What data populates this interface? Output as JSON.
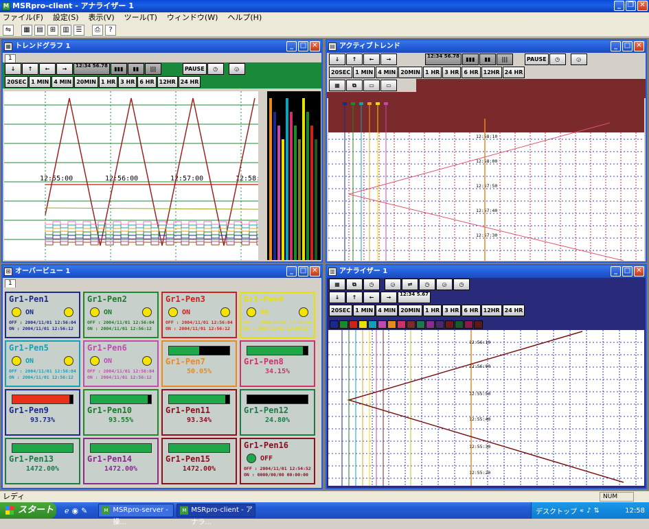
{
  "app": {
    "title": "MSRpro-client - アナライザー 1"
  },
  "menu": [
    "ファイル(F)",
    "設定(S)",
    "表示(V)",
    "ツール(T)",
    "ウィンドウ(W)",
    "ヘルプ(H)"
  ],
  "windows": {
    "trend": {
      "title": "トレンドグラフ 1",
      "tab": "1",
      "ranges": [
        "20SEC",
        "1 MIN",
        "4 MIN",
        "20MIN",
        "1 HR",
        "3 HR",
        "6 HR",
        "12HR",
        "24 HR"
      ],
      "pause": "PAUSE",
      "time_box": "12:34 56.78",
      "times": [
        "12:55:00",
        "12:56:00",
        "12:57:00",
        "12:58:00"
      ]
    },
    "active": {
      "title": "アクティブトレンド",
      "ranges": [
        "20SEC",
        "1 MIN",
        "4 MIN",
        "20MIN",
        "1 HR",
        "3 HR",
        "6 HR",
        "12HR",
        "24 HR"
      ],
      "pause": "PAUSE",
      "time_box": "12:34 56.78",
      "times": [
        "12:58:10",
        "12:58:00",
        "12:57:50",
        "12:57:40",
        "12:57:30",
        "12:57:20"
      ]
    },
    "overview": {
      "title": "オーバービュー 1",
      "tab": "1"
    },
    "analyzer": {
      "title": "アナライザー 1",
      "time_box": "12:34 5.67",
      "ranges": [
        "20SEC",
        "1 MIN",
        "4 MIN",
        "20MIN",
        "1 HR",
        "3 HR",
        "6 HR",
        "12HR",
        "24 HR"
      ],
      "times": [
        "12:56:10",
        "12:56:00",
        "12:55:50",
        "12:55:40",
        "12:55:30",
        "12:55:20"
      ]
    }
  },
  "pens": [
    {
      "name": "Gr1-Pen1",
      "kind": "lamp",
      "state": "ON",
      "off": "OFF : 2004/11/01 12:56:04",
      "on": "ON  : 2004/11/01 12:56:12",
      "color": "#1a2a8c",
      "namecolor": "#1a2a8c"
    },
    {
      "name": "Gr1-Pen2",
      "kind": "lamp",
      "state": "ON",
      "off": "OFF : 2004/11/01 12:56:04",
      "on": "ON  : 2004/11/01 12:56:12",
      "color": "#1a8a2a",
      "namecolor": "#1a7a2a"
    },
    {
      "name": "Gr1-Pen3",
      "kind": "lamp",
      "state": "ON",
      "off": "OFF : 2004/11/01 12:56:04",
      "on": "ON  : 2004/11/01 12:56:12",
      "color": "#d0201a",
      "namecolor": "#d0201a"
    },
    {
      "name": "Gr1-Pen4",
      "kind": "lamp",
      "state": "ON",
      "off": "OFF : 2004/11/01 12:56:04",
      "on": "ON  : 2004/11/01 12:56:12",
      "color": "#e8e000",
      "namecolor": "#e8e000"
    },
    {
      "name": "Gr1-Pen5",
      "kind": "lamp",
      "state": "ON",
      "off": "OFF : 2004/11/01 12:56:04",
      "on": "ON  : 2004/11/01 12:56:12",
      "color": "#10a0b8",
      "namecolor": "#10a0b8"
    },
    {
      "name": "Gr1-Pen6",
      "kind": "lamp",
      "state": "ON",
      "off": "OFF : 2004/11/01 12:56:04",
      "on": "ON  : 2004/11/01 12:56:12",
      "color": "#c04ab0",
      "namecolor": "#c04ab0"
    },
    {
      "name": "Gr1-Pen7",
      "kind": "bar",
      "value": "50.05%",
      "level": 0.5,
      "color": "#e88a20",
      "namecolor": "#e88a20"
    },
    {
      "name": "Gr1-Pen8",
      "kind": "bar",
      "value": "34.15%",
      "level": 0.92,
      "color": "#d0306a",
      "namecolor": "#d0306a"
    },
    {
      "name": "Gr1-Pen9",
      "kind": "bar",
      "value": "93.73%",
      "level": 0.94,
      "color": "#1a2a8c",
      "namecolor": "#1a2a8c",
      "fillcolor": "#e8301a"
    },
    {
      "name": "Gr1-Pen10",
      "kind": "bar",
      "value": "93.55%",
      "level": 0.94,
      "color": "#1a8a2a",
      "namecolor": "#1a7a2a"
    },
    {
      "name": "Gr1-Pen11",
      "kind": "bar",
      "value": "93.34%",
      "level": 0.93,
      "color": "#8a1020",
      "namecolor": "#8a1020"
    },
    {
      "name": "Gr1-Pen12",
      "kind": "bar",
      "value": "24.80%",
      "level": 0.0,
      "color": "#1a7a4a",
      "namecolor": "#1a7a4a"
    },
    {
      "name": "Gr1-Pen13",
      "kind": "bar",
      "value": "1472.00%",
      "level": 1.0,
      "color": "#1a7a4a",
      "namecolor": "#1a7a4a"
    },
    {
      "name": "Gr1-Pen14",
      "kind": "bar",
      "value": "1472.00%",
      "level": 1.0,
      "color": "#8a2a8a",
      "namecolor": "#8a2a8a"
    },
    {
      "name": "Gr1-Pen15",
      "kind": "bar",
      "value": "1472.00%",
      "level": 1.0,
      "color": "#8a1020",
      "namecolor": "#8a1020"
    },
    {
      "name": "Gr1-Pen16",
      "kind": "lampg",
      "state": "OFF",
      "off": "OFF : 2004/11/01 12:54:52",
      "on": "ON  : 0000/00/00 00:00:00",
      "color": "#8a1020",
      "namecolor": "#8a1020"
    }
  ],
  "status": {
    "text": "レディ",
    "num": "NUM"
  },
  "taskbar": {
    "start": "スタート",
    "tasks": [
      "MSRpro-server - 操...",
      "MSRpro-client - アナラ..."
    ],
    "tray_label": "デスクトップ",
    "clock": "12:58"
  }
}
